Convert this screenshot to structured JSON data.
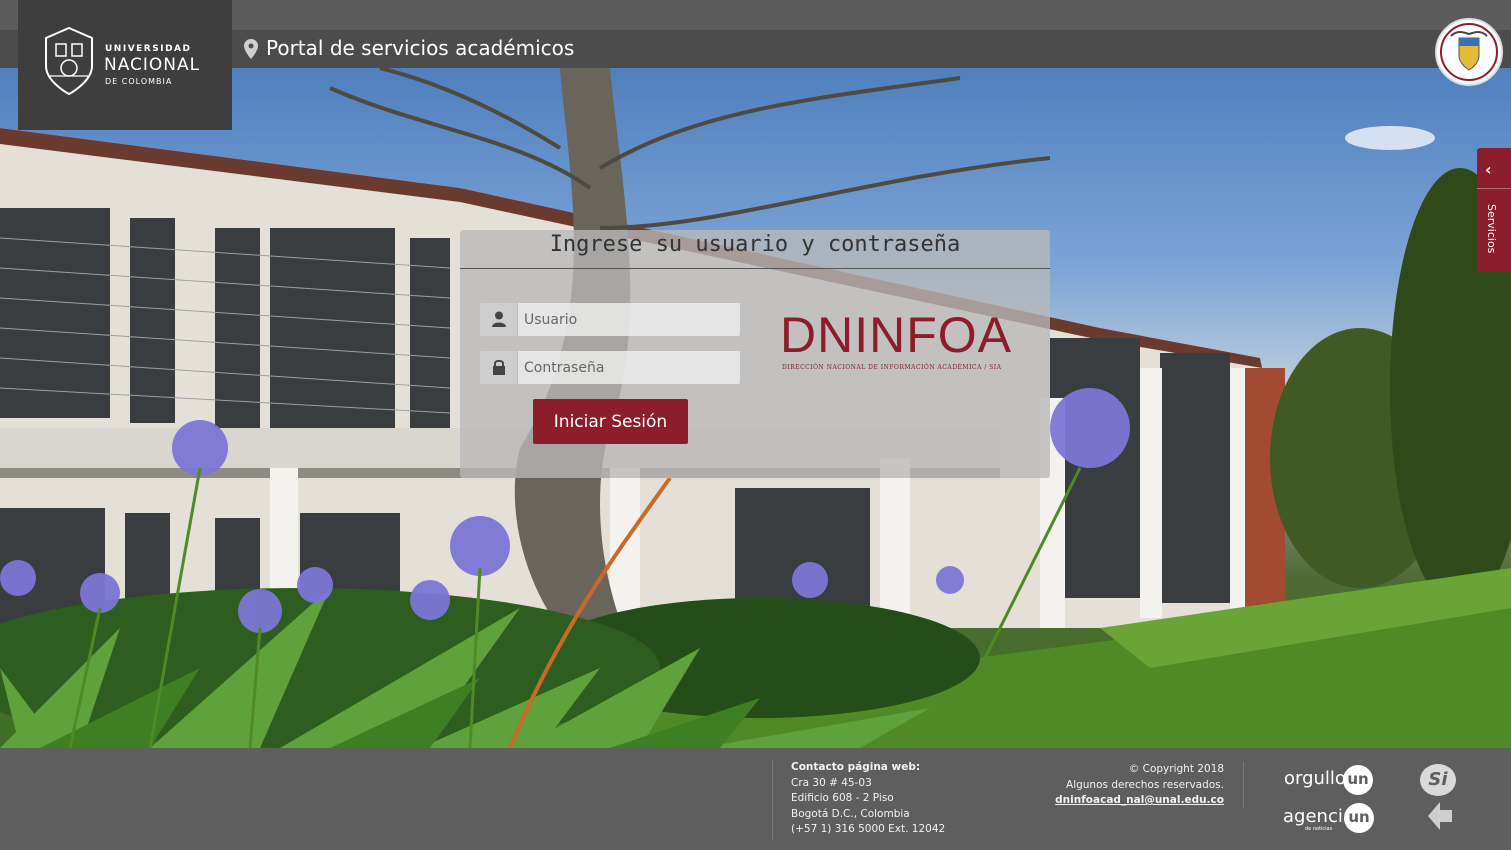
{
  "header": {
    "portal_title": "Portal de servicios académicos"
  },
  "logo": {
    "line1": "UNIVERSIDAD",
    "line2": "NACIONAL",
    "line3": "DE COLOMBIA"
  },
  "side_tab": {
    "label": "Servicios",
    "chevron": "‹"
  },
  "login": {
    "heading": "Ingrese su usuario y contraseña",
    "username_placeholder": "Usuario",
    "username_value": "",
    "password_placeholder": "Contraseña",
    "password_value": "",
    "submit_label": "Iniciar Sesión"
  },
  "dninfoa": {
    "wordmark": "DNINFOA",
    "subtitle": "DIRECCIÓN NACIONAL DE INFORMACIÓN ACADÉMICA / SIA"
  },
  "footer": {
    "contact_heading": "Contacto página web:",
    "address1": "Cra 30 # 45-03",
    "address2": "Edificio 608 - 2 Piso",
    "city": "Bogotá D.C., Colombia",
    "phone": "(+57 1) 316 5000 Ext. 12042",
    "copyright": "© Copyright 2018",
    "rights": "Algunos derechos reservados.",
    "email": "dninfoacad_nal@unal.edu.co",
    "brand1": "orgullo",
    "brand2": "agencia",
    "brand2_sub": "de noticias",
    "un": "un",
    "si": "Si"
  },
  "colors": {
    "accent": "#8c1d2b",
    "bar": "#4b4b4b",
    "footer": "#5e5e5e"
  },
  "icons": [
    "location-pin-icon",
    "user-icon",
    "lock-icon",
    "chevron-left-icon",
    "escudo-icon",
    "back-arrow-icon"
  ]
}
